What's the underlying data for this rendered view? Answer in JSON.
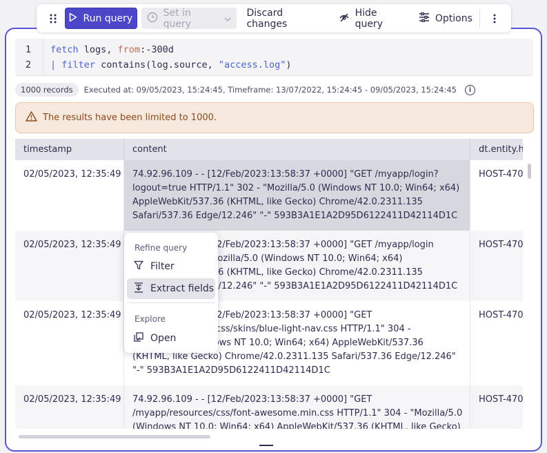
{
  "toolbar": {
    "run_label": "Run query",
    "set_label": "Set in query",
    "discard_label": "Discard changes",
    "hide_label": "Hide query",
    "options_label": "Options"
  },
  "editor": {
    "lines": [
      {
        "num": "1",
        "keyword": "fetch",
        "text": " logs, ",
        "param": "from",
        "rest": ":-300d",
        "string": ""
      },
      {
        "num": "2",
        "keyword": "| filter",
        "text": " contains(log.source, ",
        "param": "",
        "rest": ")",
        "string": "\"access.log\""
      }
    ]
  },
  "meta": {
    "records": "1000 records",
    "executed": "Executed at: 09/05/2023, 15:24:45, Timeframe: 13/07/2022, 15:24:45 - 09/05/2023, 15:24:45"
  },
  "warning": {
    "text": "The results have been limited to 1000."
  },
  "table": {
    "columns": [
      "timestamp",
      "content",
      "dt.entity.h"
    ],
    "rows": [
      {
        "timestamp": "02/05/2023, 12:35:49",
        "content": "74.92.96.109 - - [12/Feb/2023:13:58:37 +0000] \"GET /myapp/login?logout=true HTTP/1.1\" 302 - \"Mozilla/5.0 (Windows NT 10.0; Win64; x64) AppleWebKit/537.36 (KHTML, like Gecko) Chrome/42.0.2311.135 Safari/537.36 Edge/12.246\" \"-\" 593B3A1E1A2D95D6122411D42114D1C",
        "host": "HOST-470"
      },
      {
        "timestamp": "02/05/2023, 12:35:49",
        "content": "74.92.96.109 - - [12/Feb/2023:13:58:37 +0000] \"GET /myapp/login HTTP/1.1\" 200 - \"Mozilla/5.0 (Windows NT 10.0; Win64; x64) AppleWebKit/537.36 (KHTML, like Gecko) Chrome/42.0.2311.135 Safari/537.36 Edge/12.246\" \"-\" 593B3A1E1A2D95D6122411D42114D1C",
        "host": "HOST-470"
      },
      {
        "timestamp": "02/05/2023, 12:35:49",
        "content": "74.92.96.109 - - [12/Feb/2023:13:58:37 +0000] \"GET /myapp/resources/css/skins/blue-light-nav.css HTTP/1.1\" 304 - \"Mozilla/5.0 (Windows NT 10.0; Win64; x64) AppleWebKit/537.36 (KHTML, like Gecko) Chrome/42.0.2311.135 Safari/537.36 Edge/12.246\" \"-\" 593B3A1E1A2D95D6122411D42114D1C",
        "host": "HOST-470"
      },
      {
        "timestamp": "02/05/2023, 12:35:49",
        "content": "74.92.96.109 - - [12/Feb/2023:13:58:37 +0000] \"GET /myapp/resources/css/font-awesome.min.css HTTP/1.1\" 304 - \"Mozilla/5.0 (Windows NT 10.0; Win64; x64) AppleWebKit/537.36 (KHTML, like Gecko)",
        "host": "HOST-470"
      }
    ]
  },
  "context_menu": {
    "refine_heading": "Refine query",
    "filter_label": "Filter",
    "extract_label": "Extract fields",
    "explore_heading": "Explore",
    "open_label": "Open"
  }
}
